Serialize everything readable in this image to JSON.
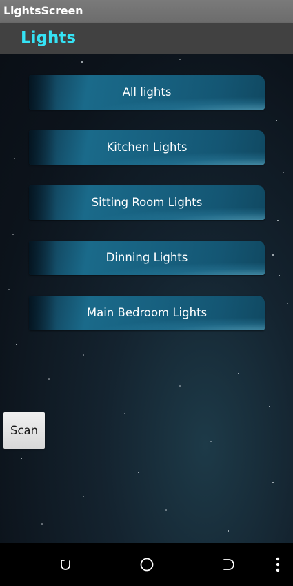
{
  "window": {
    "title": "LightsScreen"
  },
  "header": {
    "title": "Lights",
    "title_color": "#35e3f5"
  },
  "light_buttons": [
    {
      "label": "All lights"
    },
    {
      "label": "Kitchen Lights"
    },
    {
      "label": "Sitting Room Lights"
    },
    {
      "label": "Dinning Lights"
    },
    {
      "label": "Main Bedroom Lights"
    }
  ],
  "scan_button": {
    "label": "Scan"
  },
  "navbar": {
    "icons": [
      "recent-apps-icon",
      "home-icon",
      "back-icon",
      "overflow-menu-icon"
    ]
  }
}
